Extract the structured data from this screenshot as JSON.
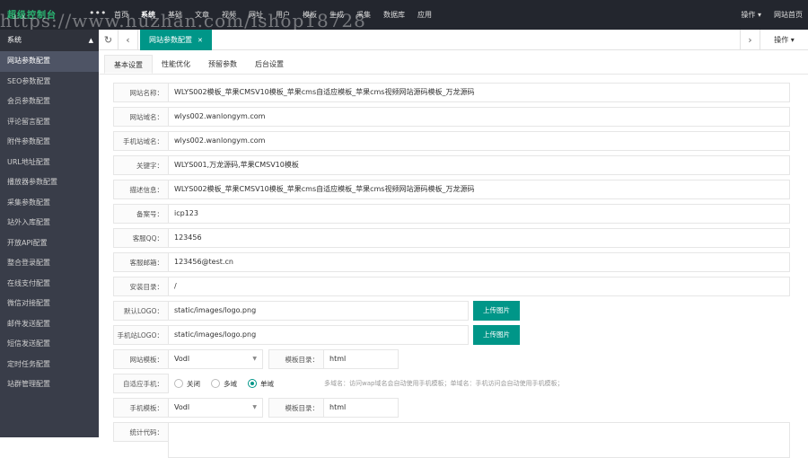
{
  "top": {
    "logo": "超级控制台",
    "dots": "•••",
    "nav": [
      "首页",
      "系统",
      "基础",
      "文章",
      "视频",
      "网址",
      "用户",
      "模板",
      "生成",
      "采集",
      "数据库",
      "应用"
    ],
    "active_nav": 1,
    "ops_label": "操作",
    "home_label": "网站首页",
    "watermark": "https://www.huzhan.com/ishop18728"
  },
  "sidebar": {
    "title": "系统",
    "items": [
      "网站参数配置",
      "SEO参数配置",
      "会员参数配置",
      "评论留言配置",
      "附件参数配置",
      "URL地址配置",
      "播放器参数配置",
      "采集参数配置",
      "站外入库配置",
      "开放API配置",
      "整合登录配置",
      "在线支付配置",
      "微信对接配置",
      "邮件发送配置",
      "短信发送配置",
      "定时任务配置",
      "站群管理配置"
    ],
    "active_index": 0
  },
  "tabbar": {
    "tab_label": "网站参数配置",
    "ops_label": "操作"
  },
  "subtabs": [
    "基本设置",
    "性能优化",
    "预留参数",
    "后台设置"
  ],
  "form": {
    "site_name_label": "网站名称：",
    "site_name": "WLYS002模板_苹果CMSV10模板_苹果cms自适应模板_苹果cms视频网站源码模板_万龙源码",
    "site_domain_label": "网站域名：",
    "site_domain": "wlys002.wanlongym.com",
    "mobile_domain_label": "手机站域名：",
    "mobile_domain": "wlys002.wanlongym.com",
    "keywords_label": "关键字：",
    "keywords": "WLYS001,万龙源码,苹果CMSV10模板",
    "description_label": "描述信息：",
    "description": "WLYS002模板_苹果CMSV10模板_苹果cms自适应模板_苹果cms视频网站源码模板_万龙源码",
    "icp_label": "备案号：",
    "icp": "icp123",
    "qq_label": "客服QQ：",
    "qq": "123456",
    "email_label": "客服邮箱：",
    "email": "123456@test.cn",
    "install_dir_label": "安装目录：",
    "install_dir": "/",
    "logo_label": "默认LOGO：",
    "logo": "static/images/logo.png",
    "upload_label": "上传图片",
    "mobile_logo_label": "手机站LOGO：",
    "mobile_logo": "static/images/logo.png",
    "template_label": "网站模板：",
    "template": "Vodl",
    "template_dir_label": "模板目录：",
    "template_dir": "html",
    "adaptive_label": "自适应手机：",
    "radio_options": [
      "关闭",
      "多域",
      "单域"
    ],
    "radio_selected": 2,
    "adaptive_hint": "多域名：访问wap域名会自动使用手机模板；单域名：手机访问会自动使用手机模板；",
    "mobile_template_label": "手机模板：",
    "mobile_template": "Vodl",
    "mobile_template_dir_label": "模板目录：",
    "mobile_template_dir": "html",
    "stat_label": "统计代码："
  },
  "colors": {
    "accent": "#009688",
    "topbar": "#23262e",
    "sidebar": "#393d49"
  }
}
